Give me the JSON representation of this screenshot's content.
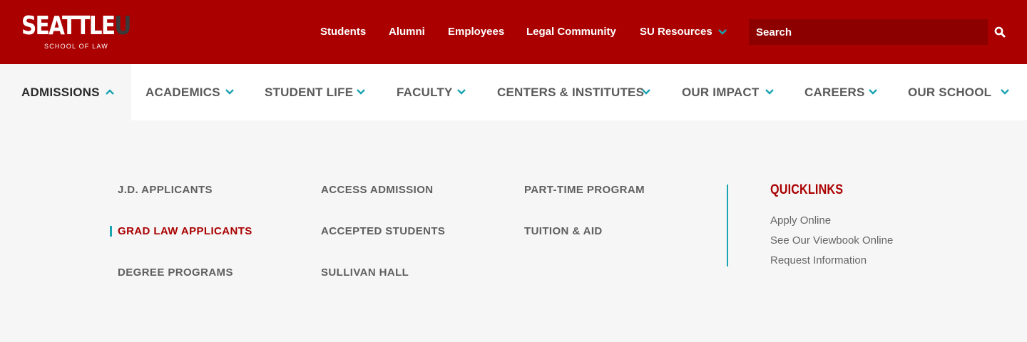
{
  "brand": {
    "logo_main": "SEATTLE",
    "logo_u": "U",
    "logo_sub": "SCHOOL OF LAW"
  },
  "utility_nav": {
    "items": [
      "Students",
      "Alumni",
      "Employees",
      "Legal Community",
      "SU Resources"
    ],
    "search_placeholder": "Search"
  },
  "main_nav": {
    "items": [
      {
        "label": "ADMISSIONS",
        "active": true
      },
      {
        "label": "ACADEMICS",
        "active": false
      },
      {
        "label": "STUDENT LIFE",
        "active": false
      },
      {
        "label": "FACULTY",
        "active": false
      },
      {
        "label": "CENTERS & INSTITUTES",
        "active": false
      },
      {
        "label": "OUR IMPACT",
        "active": false
      },
      {
        "label": "CAREERS",
        "active": false
      },
      {
        "label": "OUR SCHOOL",
        "active": false
      }
    ]
  },
  "mega_menu": {
    "columns": [
      [
        "J.D. APPLICANTS",
        "GRAD LAW APPLICANTS",
        "DEGREE PROGRAMS"
      ],
      [
        "ACCESS ADMISSION",
        "ACCEPTED STUDENTS",
        "SULLIVAN HALL"
      ],
      [
        "PART-TIME PROGRAM",
        "TUITION & AID"
      ]
    ],
    "current_item": "GRAD LAW APPLICANTS",
    "quicklinks": {
      "title": "QUICKLINKS",
      "items": [
        "Apply Online",
        "See Our Viewbook Online",
        "Request Information"
      ]
    }
  },
  "colors": {
    "brand_red": "#aa0000",
    "search_bg": "#8c0000",
    "accent_teal": "#1aa3b0",
    "text_gray": "#5f5f5f",
    "menu_bg": "#f6f6f6"
  }
}
